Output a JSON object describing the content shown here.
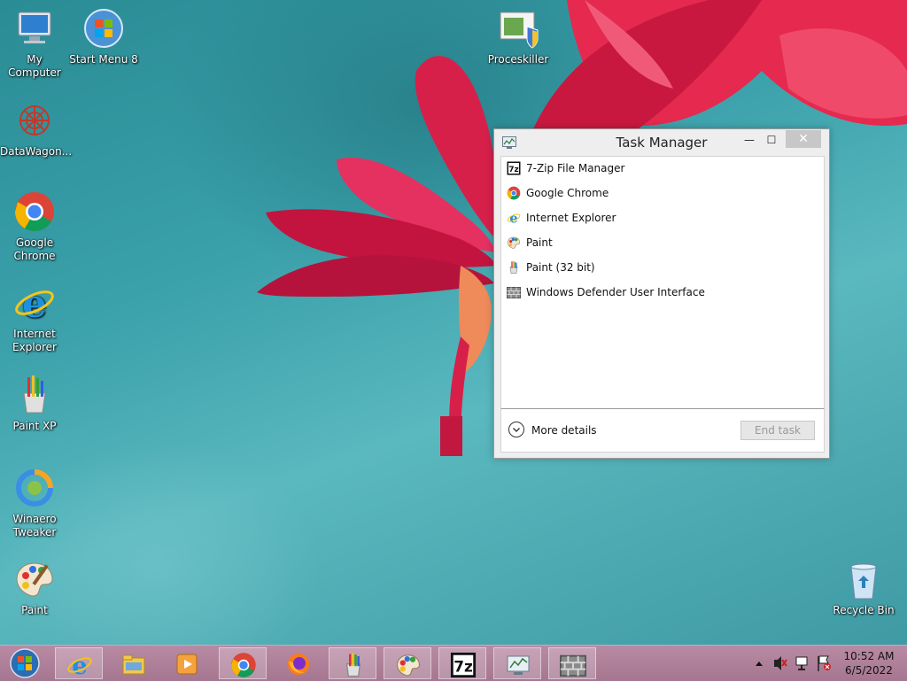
{
  "desktop": {
    "icons": [
      {
        "label": "My Computer",
        "icon": "computer-icon"
      },
      {
        "label": "Start Menu 8",
        "icon": "start-orb-icon"
      },
      {
        "label": "DataWagon...",
        "icon": "datawagon-icon"
      },
      {
        "label": "Google\nChrome",
        "icon": "chrome-icon"
      },
      {
        "label": "Internet\nExplorer",
        "icon": "internet-explorer-icon"
      },
      {
        "label": "Paint XP",
        "icon": "paint-xp-icon"
      },
      {
        "label": "Winaero\nTweaker",
        "icon": "winaero-tweaker-icon"
      },
      {
        "label": "Paint",
        "icon": "paint-palette-icon"
      },
      {
        "label": "Proceskiller",
        "icon": "proceskiller-icon"
      },
      {
        "label": "Recycle Bin",
        "icon": "recycle-bin-icon"
      }
    ]
  },
  "task_manager": {
    "title": "Task Manager",
    "window_buttons": {
      "minimize": "—",
      "maximize": "☐",
      "close": "✕"
    },
    "apps": [
      {
        "name": "7-Zip File Manager",
        "icon": "7zip-icon"
      },
      {
        "name": "Google Chrome",
        "icon": "chrome-icon"
      },
      {
        "name": "Internet Explorer",
        "icon": "internet-explorer-icon"
      },
      {
        "name": "Paint",
        "icon": "paint-palette-icon"
      },
      {
        "name": "Paint (32 bit)",
        "icon": "paint-xp-icon"
      },
      {
        "name": "Windows Defender User Interface",
        "icon": "defender-wall-icon"
      }
    ],
    "more_details": "More details",
    "end_task": "End task"
  },
  "taskbar": {
    "pinned": [
      "start-orb-icon",
      "internet-explorer-icon",
      "file-explorer-icon",
      "media-player-icon",
      "chrome-icon",
      "firefox-icon",
      "paint-xp-icon",
      "paint-palette-icon",
      "7zip-icon",
      "task-manager-icon",
      "defender-wall-icon"
    ],
    "clock": {
      "time": "10:52 AM",
      "date": "6/5/2022"
    }
  },
  "colors": {
    "desktop": "#3aa0aa",
    "taskbar": "#b07f9a",
    "flower": "#e0244f"
  }
}
